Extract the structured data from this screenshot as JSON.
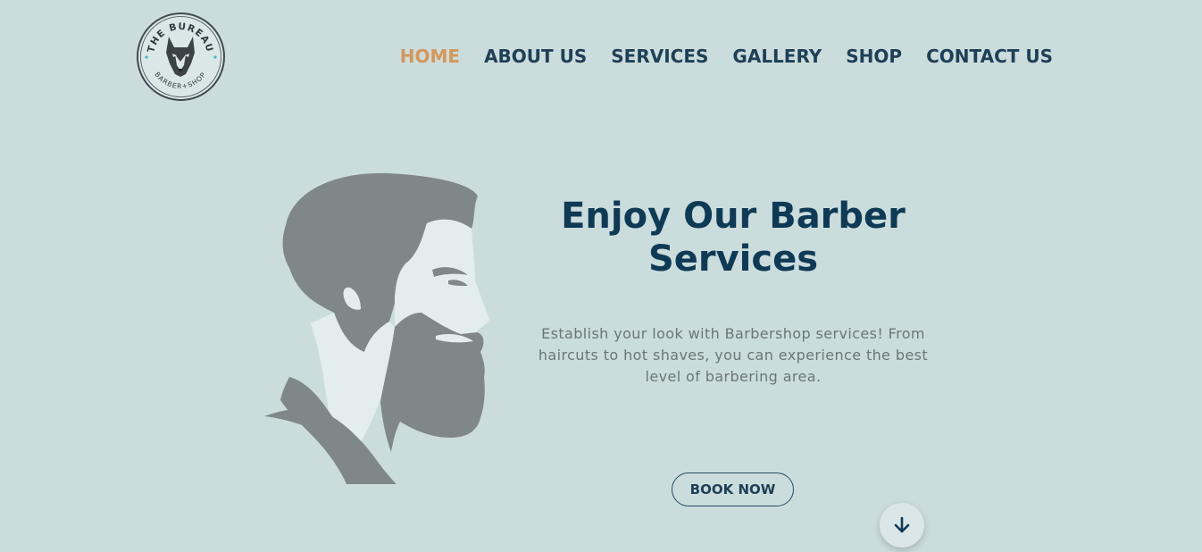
{
  "logo": {
    "top_text": "THE BUREAU",
    "bottom_text": "BARBER+SHOP",
    "icon": "wolf-head-icon"
  },
  "nav": {
    "items": [
      {
        "label": "HOME",
        "active": true
      },
      {
        "label": "ABOUT US",
        "active": false
      },
      {
        "label": "SERVICES",
        "active": false
      },
      {
        "label": "GALLERY",
        "active": false
      },
      {
        "label": "SHOP",
        "active": false
      },
      {
        "label": "CONTACT US",
        "active": false
      }
    ]
  },
  "hero": {
    "title": "Enjoy Our Barber Services",
    "subtitle": "Establish your look with Barbershop services! From haircuts to hot shaves, you can experience the best level of barbering area.",
    "cta_label": "BOOK NOW",
    "illustration": "bearded-man-profile-icon",
    "scroll_icon": "arrow-down-icon"
  },
  "colors": {
    "background": "#cbdcdd",
    "nav_text": "#1f3f56",
    "nav_active": "#d4975a",
    "title": "#0f3a55",
    "subtitle": "#6b7676",
    "illustration_gray": "#808789",
    "illustration_light": "#e3edee"
  }
}
